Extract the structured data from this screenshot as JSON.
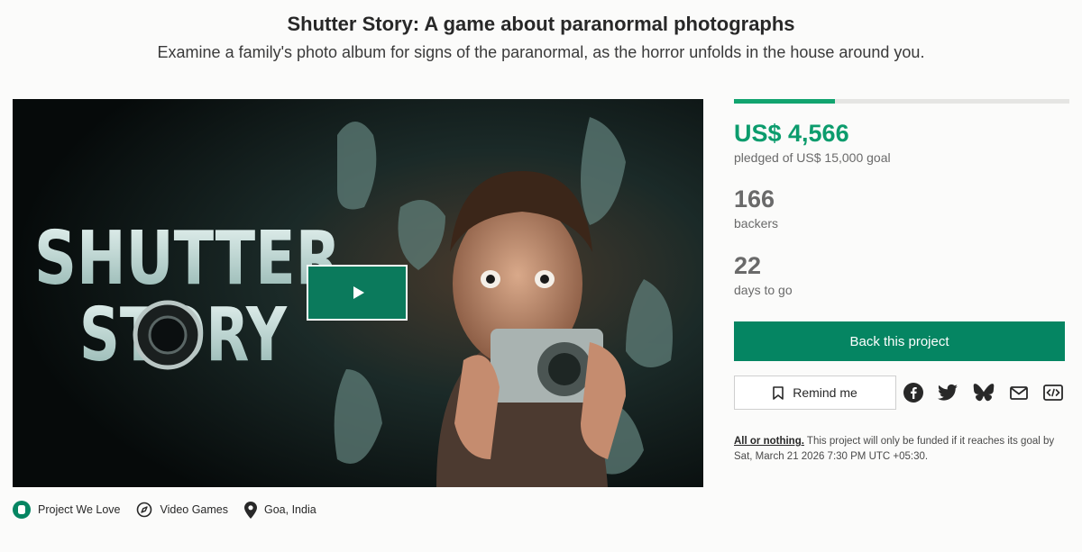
{
  "header": {
    "title": "Shutter Story: A game about paranormal photographs",
    "subtitle": "Examine a family's photo album for signs of the paranormal, as the horror unfolds in the house around you."
  },
  "video": {
    "logo_line1": "SHUTTER",
    "logo_line2": "STORY",
    "play_icon": "play-icon"
  },
  "funding": {
    "progress_fraction": 0.3,
    "pledged_amount": "US$ 4,566",
    "pledged_label": "pledged of US$ 15,000 goal",
    "backers_count": "166",
    "backers_label": "backers",
    "days_count": "22",
    "days_label": "days to go"
  },
  "actions": {
    "back_label": "Back this project",
    "remind_label": "Remind me",
    "share_icons": [
      "facebook-icon",
      "twitter-icon",
      "bluesky-icon",
      "email-icon",
      "embed-icon"
    ]
  },
  "note": {
    "all_or_nothing": "All or nothing.",
    "text": " This project will only be funded if it reaches its goal by Sat, March 21 2026 7:30 PM UTC +05:30."
  },
  "tags": [
    {
      "label": "Project We Love",
      "icon": "kickstarter-badge-icon"
    },
    {
      "label": "Video Games",
      "icon": "compass-icon"
    },
    {
      "label": "Goa, India",
      "icon": "location-pin-icon"
    }
  ],
  "colors": {
    "accent": "#058562",
    "pledged_text": "#0c9c6d",
    "progress_fill": "#11a46f"
  }
}
